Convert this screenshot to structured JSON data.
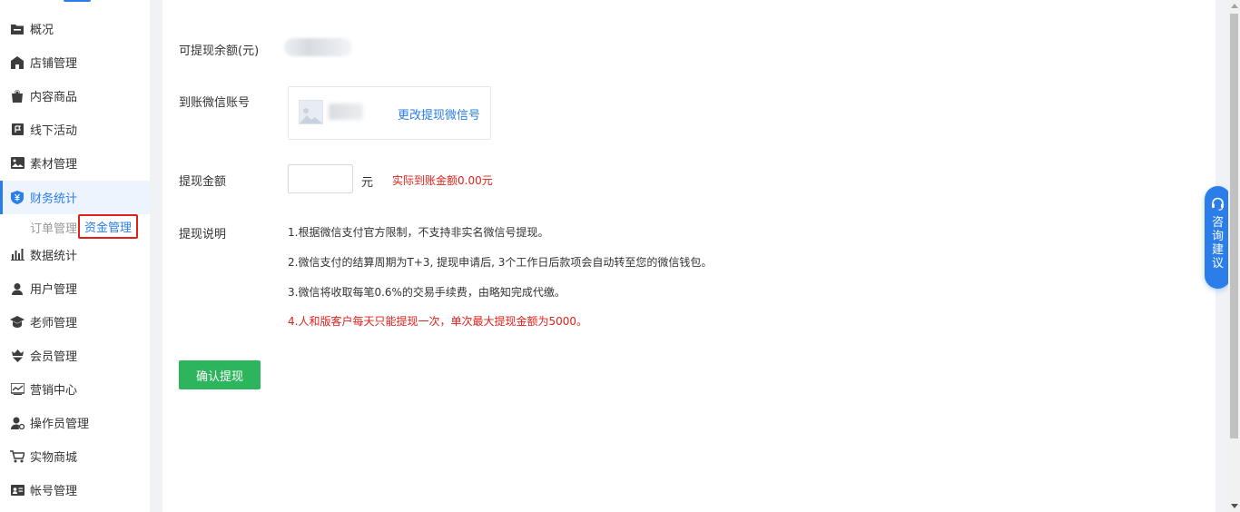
{
  "sidebar": {
    "items": [
      {
        "label": "概况",
        "icon": "folder-icon"
      },
      {
        "label": "店铺管理",
        "icon": "store-icon"
      },
      {
        "label": "内容商品",
        "icon": "bag-icon"
      },
      {
        "label": "线下活动",
        "icon": "flag-icon"
      },
      {
        "label": "素材管理",
        "icon": "image-icon"
      },
      {
        "label": "财务统计",
        "icon": "yuan-shield-icon",
        "active": true
      },
      {
        "label": "数据统计",
        "icon": "bar-chart-icon"
      },
      {
        "label": "用户管理",
        "icon": "user-icon"
      },
      {
        "label": "老师管理",
        "icon": "graduation-cap-icon"
      },
      {
        "label": "会员管理",
        "icon": "crown-heart-icon"
      },
      {
        "label": "营销中心",
        "icon": "trend-chart-icon"
      },
      {
        "label": "操作员管理",
        "icon": "operator-icon"
      },
      {
        "label": "实物商城",
        "icon": "cart-icon"
      },
      {
        "label": "帐号管理",
        "icon": "id-card-icon"
      }
    ],
    "subnav": {
      "order_label": "订单管理",
      "funds_label": "资金管理"
    }
  },
  "form": {
    "balance_label": "可提现余额(元)",
    "account_label": "到账微信账号",
    "change_wechat_link": "更改提现微信号",
    "amount_label": "提现金额",
    "amount_value": "",
    "unit": "元",
    "actual_amount_text": "实际到账金额0.00元",
    "notes_label": "提现说明",
    "notes": [
      "1.根据微信支付官方限制，不支持非实名微信号提现。",
      "2.微信支付的结算周期为T+3, 提现申请后, 3个工作日后款项会自动转至您的微信钱包。",
      "3.微信将收取每笔0.6%的交易手续费，由略知完成代缴。",
      "4.人和版客户每天只能提现一次，单次最大提现金额为5000。"
    ],
    "confirm_button": "确认提现"
  },
  "floating": {
    "consult_chars": [
      "咨",
      "询",
      "建",
      "议"
    ]
  },
  "colors": {
    "accent": "#2b7de9",
    "warning": "#e0201a",
    "confirm": "#2db55d"
  }
}
